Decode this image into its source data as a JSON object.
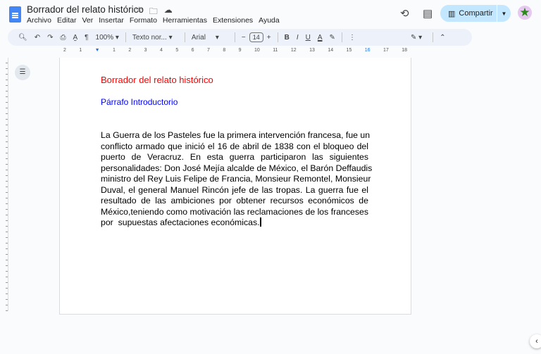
{
  "header": {
    "title": "Borrador del relato histórico",
    "menu": [
      "Archivo",
      "Editar",
      "Ver",
      "Insertar",
      "Formato",
      "Herramientas",
      "Extensiones",
      "Ayuda"
    ],
    "share_label": "Compartir"
  },
  "toolbar": {
    "zoom": "100%",
    "style": "Texto nor...",
    "font": "Arial",
    "font_size": "14"
  },
  "ruler": {
    "ticks": [
      "2",
      "1",
      "",
      "1",
      "2",
      "3",
      "4",
      "5",
      "6",
      "7",
      "8",
      "9",
      "10",
      "11",
      "12",
      "13",
      "14",
      "15",
      "16",
      "17",
      "18"
    ]
  },
  "document": {
    "title": "Borrador del relato histórico",
    "subtitle": "Párrafo Introductorio",
    "lines": [
      "La Guerra de los Pasteles fue la primera intervención francesa, fue un",
      "conflicto armado que inició el 16 de abril de 1838 con el bloqueo del",
      "puerto de Veracruz. En esta guerra participaron las siguientes",
      "personalidades: Don José Mejía alcalde de México, el Barón Deffaudis",
      "ministro del Rey Luis Felipe de Francia, Monsieur Remontel, Monsieur",
      "Duval, el general Manuel Rincón jefe de las tropas. La guerra fue el",
      "resultado de las ambiciones por obtener recursos económicos de",
      "México,teniendo como motivación las reclamaciones de los franceses",
      "por  supuestas afectaciones económicas."
    ],
    "title_color": "#ff0000",
    "subtitle_color": "#0000ff"
  }
}
